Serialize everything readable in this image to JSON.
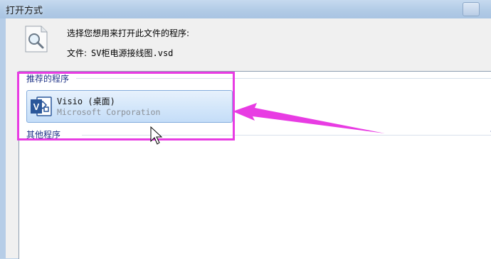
{
  "window": {
    "title": "打开方式"
  },
  "header": {
    "prompt": "选择您想用来打开此文件的程序:",
    "file_label": "文件:",
    "file_name": "SV柜电源接线图.vsd"
  },
  "groups": {
    "recommended": "推荐的程序",
    "other": "其他程序"
  },
  "programs": [
    {
      "name": "Visio (桌面)",
      "publisher": "Microsoft Corporation",
      "icon": "visio-icon"
    }
  ],
  "colors": {
    "accent_highlight": "#e83ce3",
    "selection_bg": "#cfe4fa",
    "group_header": "#1e3287",
    "visio_blue": "#2b579a"
  }
}
